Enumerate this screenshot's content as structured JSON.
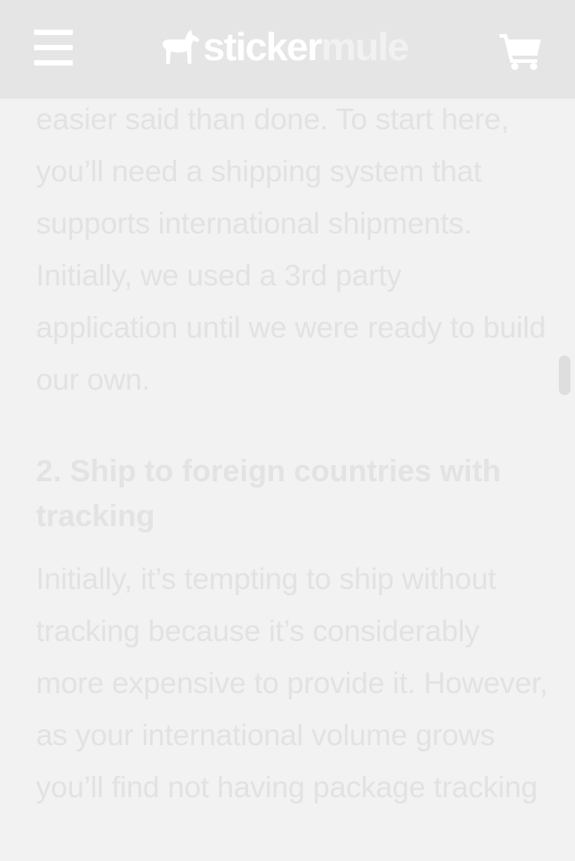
{
  "header": {
    "menu_icon": "hamburger-menu-icon",
    "logo": {
      "part1": "sticker",
      "part2": "mule",
      "icon": "mule-logo-icon"
    },
    "cart_icon": "shopping-cart-icon"
  },
  "article": {
    "paragraph1": "easier said than done. To start here, you’ll need a shipping system that supports international shipments. Initially, we used a 3rd party application until we were ready to build our own.",
    "heading": "2. Ship to foreign countries with tracking",
    "paragraph2": "Initially, it’s tempting to ship without tracking because it’s considerably more expensive to provide it. However, as your international volume grows you’ll find not having package tracking"
  },
  "colors": {
    "header_bg": "#e5e5e5",
    "page_bg": "#f2f2f2",
    "text": "#e2e2e2",
    "icon": "#ffffff"
  }
}
